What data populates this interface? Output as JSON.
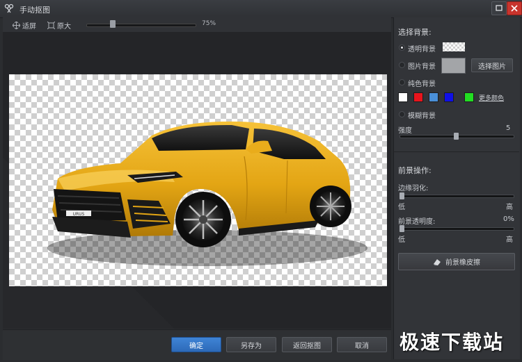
{
  "window": {
    "title": "手动抠图"
  },
  "toolbar": {
    "fit_label": "适屏",
    "actual_label": "原大",
    "zoom_value": "75%",
    "zoom_level": 0.2
  },
  "footer": {
    "ok": "确定",
    "save_as": "另存为",
    "back": "返回抠图",
    "cancel": "取消"
  },
  "panel": {
    "background_title": "选择背景:",
    "transparent_bg": "透明背景",
    "image_bg": "图片背景",
    "choose_image": "选择图片",
    "solid_bg": "纯色背景",
    "more_colors": "更多颜色",
    "blur_bg": "模糊背景",
    "strength_label": "强度",
    "strength_value": "5",
    "strength_level": 0.5,
    "foreground_title": "前景操作:",
    "feather_label": "边缘羽化:",
    "low": "低",
    "high": "高",
    "opacity_label": "前景透明度:",
    "opacity_value": "0%",
    "eraser": "前景橡皮擦",
    "colors": [
      "#ffffff",
      "#e8141c",
      "#4a8fd8",
      "#1010e6",
      "#22dd22"
    ]
  },
  "watermark": "极速下载站"
}
